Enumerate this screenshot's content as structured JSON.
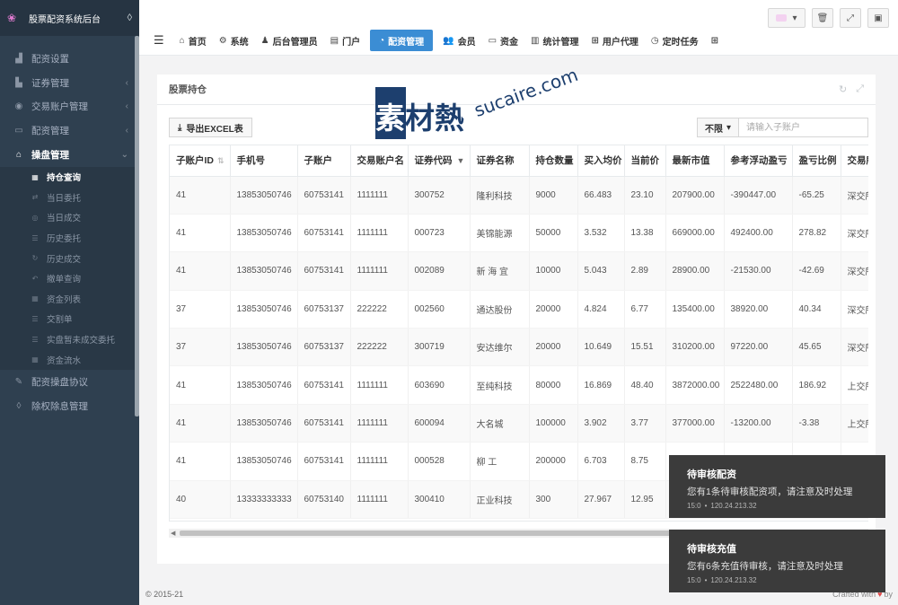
{
  "sidebar": {
    "brand": "股票配资系统后台",
    "menu": [
      {
        "label": "配资设置",
        "icon": "chart-icon",
        "has_arrow": false
      },
      {
        "label": "证券管理",
        "icon": "bar-chart-icon",
        "has_arrow": true
      },
      {
        "label": "交易账户管理",
        "icon": "user-circle-icon",
        "has_arrow": true
      },
      {
        "label": "配资管理",
        "icon": "folder-icon",
        "has_arrow": true
      },
      {
        "label": "操盘管理",
        "icon": "bank-icon",
        "has_arrow": true,
        "active": true
      }
    ],
    "submenu": [
      {
        "label": "持仓查询",
        "icon": "table-icon",
        "active": true
      },
      {
        "label": "当日委托",
        "icon": "exchange-icon"
      },
      {
        "label": "当日成交",
        "icon": "eye-icon"
      },
      {
        "label": "历史委托",
        "icon": "list-icon"
      },
      {
        "label": "历史成交",
        "icon": "refresh-icon"
      },
      {
        "label": "撤单查询",
        "icon": "undo-icon"
      },
      {
        "label": "资金列表",
        "icon": "table-icon"
      },
      {
        "label": "交割单",
        "icon": "list-icon"
      },
      {
        "label": "实盘暂未成交委托",
        "icon": "list-icon"
      },
      {
        "label": "资金流水",
        "icon": "table-icon"
      }
    ],
    "menu_bottom": [
      {
        "label": "配资操盘协议",
        "icon": "pencil-icon"
      },
      {
        "label": "除权除息管理",
        "icon": "drop-icon"
      }
    ]
  },
  "topnav": [
    {
      "label": "首页",
      "icon": "home-icon"
    },
    {
      "label": "系统",
      "icon": "gear-icon"
    },
    {
      "label": "后台管理员",
      "icon": "user-icon"
    },
    {
      "label": "门户",
      "icon": "id-card-icon"
    },
    {
      "label": "配资管理",
      "icon": "pie-chart-icon",
      "active": true
    },
    {
      "label": "会员",
      "icon": "users-icon"
    },
    {
      "label": "资金",
      "icon": "money-icon"
    },
    {
      "label": "统计管理",
      "icon": "report-icon"
    },
    {
      "label": "用户代理",
      "icon": "sitemap-icon"
    },
    {
      "label": "定时任务",
      "icon": "clock-icon"
    }
  ],
  "panel": {
    "title": "股票持仓",
    "export_label": "导出EXCEL表",
    "filter_select": "不限",
    "search_placeholder": "请输入子账户"
  },
  "table": {
    "columns": [
      "子账户ID",
      "手机号",
      "子账户",
      "交易账户名",
      "证券代码",
      "证券名称",
      "持仓数量",
      "买入均价",
      "当前价",
      "最新市值",
      "参考浮动盈亏",
      "盈亏比例",
      "交易所"
    ],
    "rows": [
      [
        "41",
        "13853050746",
        "60753141",
        "1111111",
        "300752",
        "隆利科技",
        "9000",
        "66.483",
        "23.10",
        "207900.00",
        "-390447.00",
        "-65.25",
        "深交所"
      ],
      [
        "41",
        "13853050746",
        "60753141",
        "1111111",
        "000723",
        "美锦能源",
        "50000",
        "3.532",
        "13.38",
        "669000.00",
        "492400.00",
        "278.82",
        "深交所"
      ],
      [
        "41",
        "13853050746",
        "60753141",
        "1111111",
        "002089",
        "新 海 宜",
        "10000",
        "5.043",
        "2.89",
        "28900.00",
        "-21530.00",
        "-42.69",
        "深交所"
      ],
      [
        "37",
        "13853050746",
        "60753137",
        "222222",
        "002560",
        "通达股份",
        "20000",
        "4.824",
        "6.77",
        "135400.00",
        "38920.00",
        "40.34",
        "深交所"
      ],
      [
        "37",
        "13853050746",
        "60753137",
        "222222",
        "300719",
        "安达维尔",
        "20000",
        "10.649",
        "15.51",
        "310200.00",
        "97220.00",
        "45.65",
        "深交所"
      ],
      [
        "41",
        "13853050746",
        "60753141",
        "1111111",
        "603690",
        "至纯科技",
        "80000",
        "16.869",
        "48.40",
        "3872000.00",
        "2522480.00",
        "186.92",
        "上交所"
      ],
      [
        "41",
        "13853050746",
        "60753141",
        "1111111",
        "600094",
        "大名城",
        "100000",
        "3.902",
        "3.77",
        "377000.00",
        "-13200.00",
        "-3.38",
        "上交所"
      ],
      [
        "41",
        "13853050746",
        "60753141",
        "1111111",
        "000528",
        "柳 工",
        "200000",
        "6.703",
        "8.75",
        "",
        "",
        "",
        ""
      ],
      [
        "40",
        "13333333333",
        "60753140",
        "1111111",
        "300410",
        "正业科技",
        "300",
        "27.967",
        "12.95",
        "",
        "",
        "",
        ""
      ]
    ]
  },
  "toasts": [
    {
      "title": "待审核配资",
      "message": "您有1条待审核配资项，请注意及时处理",
      "time": "15:0",
      "ip": "120.24.213.32"
    },
    {
      "title": "待审核充值",
      "message": "您有6条充值待审核，请注意及时处理",
      "time": "15:0",
      "ip": "120.24.213.32"
    }
  ],
  "footer": {
    "left": "© 2015-21",
    "right": "Crafted with",
    "right_suffix": "by"
  },
  "watermark": {
    "cn": "素材熱",
    "en": "sucaire.com"
  }
}
